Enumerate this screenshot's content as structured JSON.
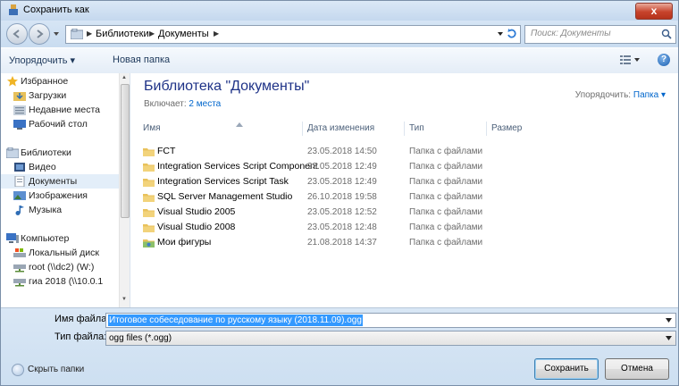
{
  "window": {
    "title": "Сохранить как",
    "close_label": "x"
  },
  "navigation": {
    "address_segments": [
      "Библиотеки",
      "Документы"
    ],
    "search_placeholder": "Поиск: Документы"
  },
  "toolbar": {
    "organize_label": "Упорядочить ▾",
    "new_folder_label": "Новая папка",
    "help_label": "?"
  },
  "nav_pane": {
    "items": [
      {
        "label": "Избранное",
        "icon": "star-icon",
        "indent": 0
      },
      {
        "label": "Загрузки",
        "icon": "downloads-folder-icon",
        "indent": 1
      },
      {
        "label": "Недавние места",
        "icon": "recent-places-icon",
        "indent": 1
      },
      {
        "label": "Рабочий стол",
        "icon": "desktop-icon",
        "indent": 1
      },
      {
        "label": "Библиотеки",
        "icon": "libraries-icon",
        "indent": 0
      },
      {
        "label": "Видео",
        "icon": "video-library-icon",
        "indent": 1
      },
      {
        "label": "Документы",
        "icon": "documents-library-icon",
        "indent": 1,
        "selected": true
      },
      {
        "label": "Изображения",
        "icon": "pictures-library-icon",
        "indent": 1
      },
      {
        "label": "Музыка",
        "icon": "music-library-icon",
        "indent": 1
      },
      {
        "label": "Компьютер",
        "icon": "computer-icon",
        "indent": 0
      },
      {
        "label": "Локальный диск",
        "icon": "local-disk-icon",
        "indent": 1
      },
      {
        "label": "root (\\\\dc2) (W:)",
        "icon": "network-drive-icon",
        "indent": 1
      },
      {
        "label": "гиа 2018 (\\\\10.0.1",
        "icon": "network-drive-icon",
        "indent": 1
      }
    ]
  },
  "library": {
    "title": "Библиотека \"Документы\"",
    "includes_prefix": "Включает:",
    "includes_link": "2 места",
    "arrange_label": "Упорядочить:",
    "arrange_value": "Папка ▾"
  },
  "columns": {
    "name": "Имя",
    "date": "Дата изменения",
    "type": "Тип",
    "size": "Размер"
  },
  "files": [
    {
      "name": "FCT",
      "date": "23.05.2018 14:50",
      "type": "Папка с файлами",
      "icon": "folder-icon"
    },
    {
      "name": "Integration Services Script Component",
      "date": "23.05.2018 12:49",
      "type": "Папка с файлами",
      "icon": "folder-icon"
    },
    {
      "name": "Integration Services Script Task",
      "date": "23.05.2018 12:49",
      "type": "Папка с файлами",
      "icon": "folder-icon"
    },
    {
      "name": "SQL Server Management Studio",
      "date": "26.10.2018 19:58",
      "type": "Папка с файлами",
      "icon": "folder-icon"
    },
    {
      "name": "Visual Studio 2005",
      "date": "23.05.2018 12:52",
      "type": "Папка с файлами",
      "icon": "folder-icon"
    },
    {
      "name": "Visual Studio 2008",
      "date": "23.05.2018 12:48",
      "type": "Папка с файлами",
      "icon": "folder-icon"
    },
    {
      "name": "Мои фигуры",
      "date": "21.08.2018 14:37",
      "type": "Папка с файлами",
      "icon": "shapes-folder-icon"
    }
  ],
  "save_form": {
    "filename_label": "Имя файла:",
    "filename_value": "Итоговое собеседование по русскому языку (2018.11.09).ogg",
    "filetype_label": "Тип файла:",
    "filetype_value": "ogg files (*.ogg)"
  },
  "footer": {
    "hide_folders_label": "Скрыть папки",
    "save_label": "Сохранить",
    "cancel_label": "Отмена"
  },
  "colors": {
    "accent": "#1e3287",
    "link": "#0066cc",
    "selection": "#3399ff"
  }
}
